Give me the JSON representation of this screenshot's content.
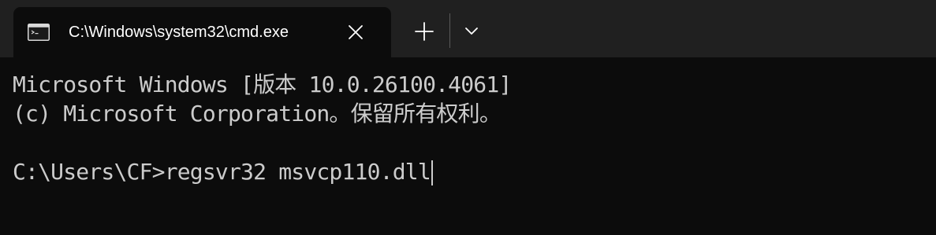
{
  "tab": {
    "title": "C:\\Windows\\system32\\cmd.exe",
    "icon": "cmd-icon",
    "close_icon": "close-icon"
  },
  "toolbar": {
    "new_tab_icon": "plus-icon",
    "dropdown_icon": "chevron-down-icon"
  },
  "console": {
    "line1": "Microsoft Windows [版本 10.0.26100.4061]",
    "line2": "(c) Microsoft Corporation。保留所有权利。",
    "line3": "",
    "prompt_line": "C:\\Users\\CF>regsvr32 msvcp110.dll"
  },
  "colors": {
    "tabbar_bg": "#202020",
    "console_bg": "#0c0c0c",
    "console_text": "#cccccc",
    "tab_title": "#ffffff"
  }
}
